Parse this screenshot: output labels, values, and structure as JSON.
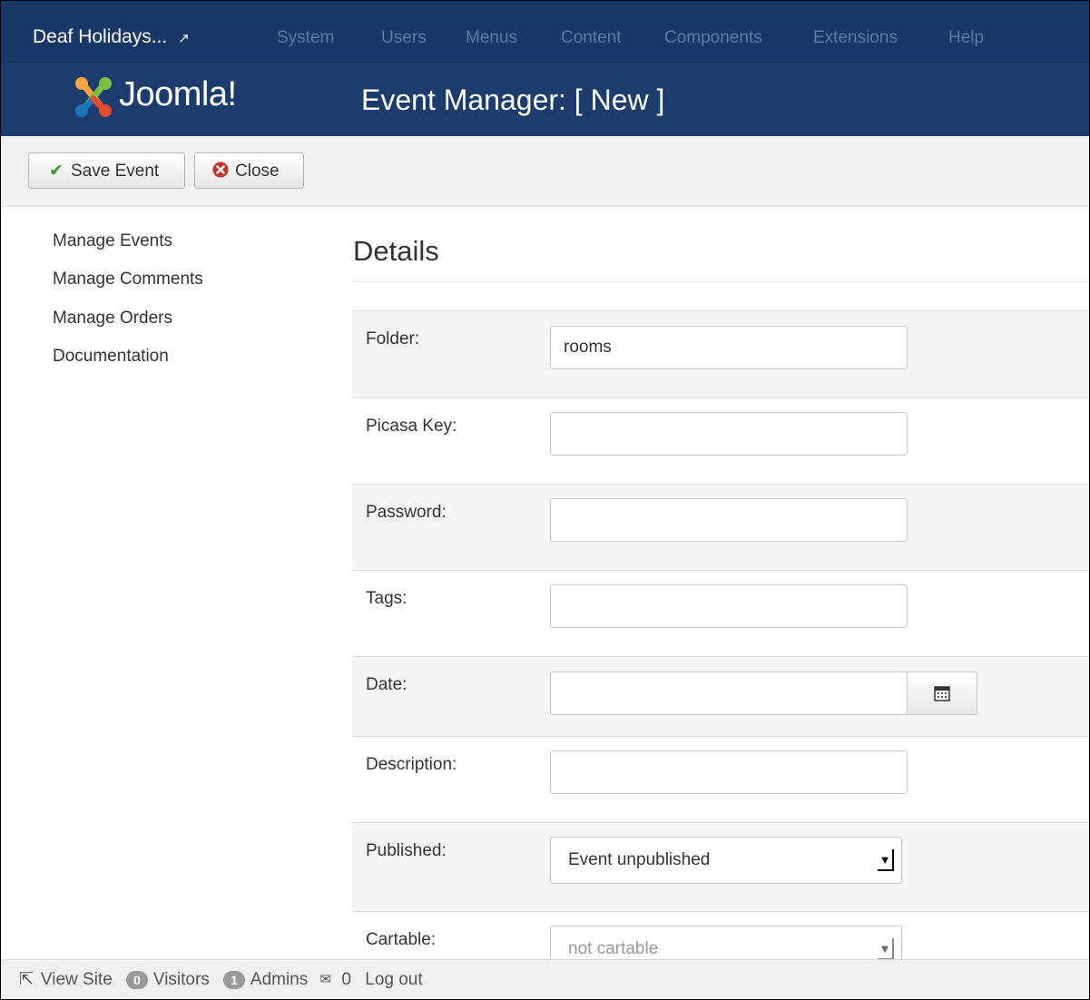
{
  "topbar": {
    "site_name": "Deaf Holidays...",
    "nav": [
      "System",
      "Users",
      "Menus",
      "Content",
      "Components",
      "Extensions",
      "Help"
    ]
  },
  "header": {
    "logo_text": "Joomla!",
    "page_title": "Event Manager: [ New ]"
  },
  "toolbar": {
    "save_label": "Save Event",
    "close_label": "Close"
  },
  "sidebar": {
    "items": [
      {
        "label": "Manage Events"
      },
      {
        "label": "Manage Comments"
      },
      {
        "label": "Manage Orders"
      },
      {
        "label": "Documentation"
      }
    ]
  },
  "details": {
    "title": "Details",
    "fields": {
      "folder": {
        "label": "Folder:",
        "value": "rooms"
      },
      "picasa_key": {
        "label": "Picasa Key:",
        "value": ""
      },
      "password": {
        "label": "Password:",
        "value": ""
      },
      "tags": {
        "label": "Tags:",
        "value": ""
      },
      "date": {
        "label": "Date:",
        "value": ""
      },
      "description": {
        "label": "Description:",
        "value": ""
      },
      "published": {
        "label": "Published:",
        "selected": "Event unpublished"
      },
      "cartable": {
        "label": "Cartable:",
        "selected": "not cartable"
      }
    }
  },
  "statusbar": {
    "view_site": "View Site",
    "visitors_count": "0",
    "visitors_label": "Visitors",
    "admins_count": "1",
    "admins_label": "Admins",
    "messages_count": "0",
    "logout": "Log out"
  },
  "colors": {
    "navbar": "#1a3867",
    "header": "#1b3c6d",
    "save_icon": "#3c9a2e",
    "close_icon": "#c9302c"
  },
  "icons": [
    "external-link-icon",
    "joomla-logo",
    "check-icon",
    "close-circle-icon",
    "calendar-icon",
    "dropdown-arrow-icon",
    "envelope-icon"
  ]
}
